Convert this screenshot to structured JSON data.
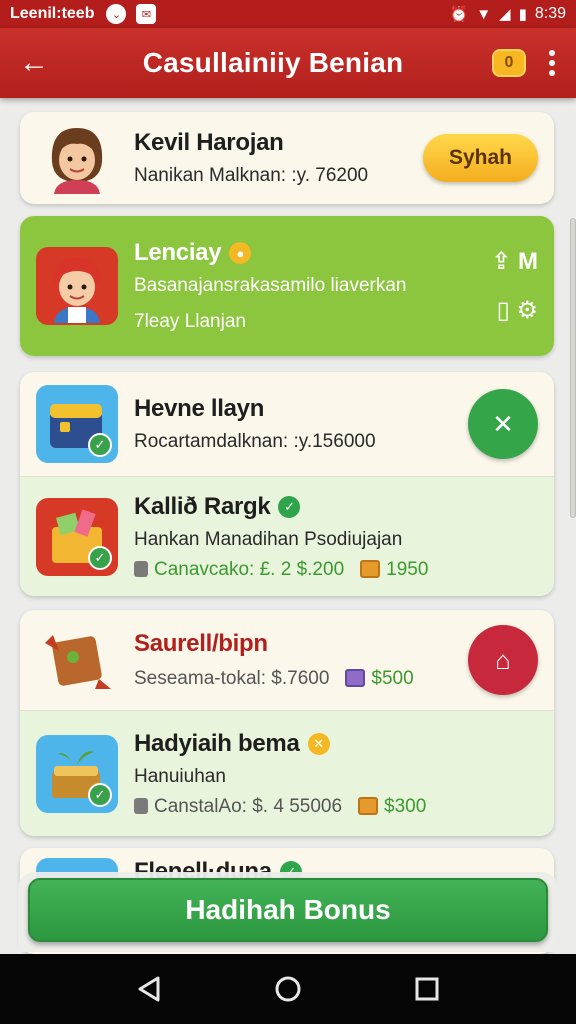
{
  "status_bar": {
    "app": "Leenil:teeb",
    "time": "8:39"
  },
  "header": {
    "title": "Casullainiiy Benian",
    "coin_label": "0"
  },
  "items": [
    {
      "name": "Kevil Harojan",
      "sub": "Nanikan Malknan: :y. 76200",
      "action_label": "Syhah"
    },
    {
      "name": "Lenciay",
      "sub": "Basanajansrakasamilo liaverkan",
      "sub2": "7leay Llanjan",
      "side_top": "M",
      "side_bottom": ""
    },
    {
      "name": "Hevne llayn",
      "sub": "Rocartamdalknan: :y.156000"
    },
    {
      "name": "Kallið Rargk",
      "sub": "Hankan Manadihan Psodiujajan",
      "cash": "Canavcako: £. 2 $.200",
      "amount": "1950"
    },
    {
      "name": "Saurell/bipn",
      "sub": "Sesеama-tokal: $.7600",
      "amount": "$500"
    },
    {
      "name": "Hadyiaih bema",
      "sub": "Hanuiuhan",
      "cash": "CanstalAo: $. 4 55006",
      "amount": "$300"
    },
    {
      "name": "Flenell·duna"
    }
  ],
  "bonus_button": "Hadihah Bonus",
  "colors": {
    "accent_red": "#b31e1c",
    "green": "#8cc63f",
    "button_green": "#35a54a",
    "gold": "#f3b824"
  }
}
